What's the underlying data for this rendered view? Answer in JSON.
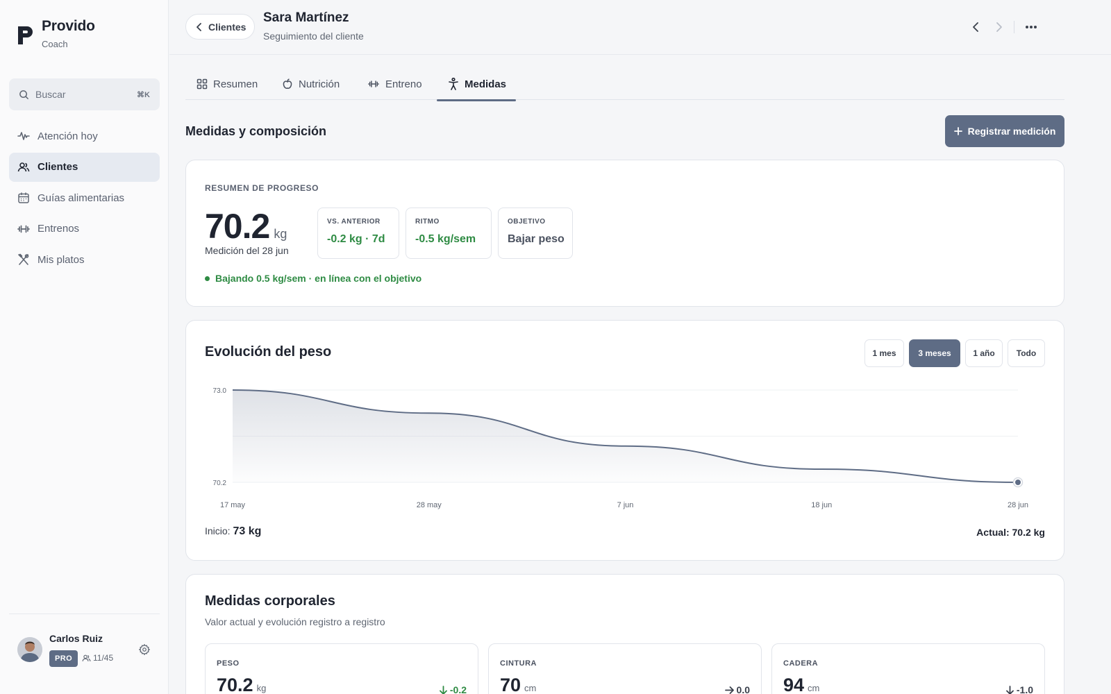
{
  "brand": {
    "name": "Provido",
    "sub": "Coach"
  },
  "search": {
    "placeholder": "Buscar",
    "shortcut": "⌘K"
  },
  "sidebar": {
    "items": [
      {
        "label": "Atención hoy",
        "icon": "activity-icon",
        "active": false
      },
      {
        "label": "Clientes",
        "icon": "users-icon",
        "active": true
      },
      {
        "label": "Guías alimentarias",
        "icon": "calendar-icon",
        "active": false
      },
      {
        "label": "Entrenos",
        "icon": "dumbbell-icon",
        "active": false
      },
      {
        "label": "Mis platos",
        "icon": "utensils-icon",
        "active": false
      }
    ]
  },
  "user": {
    "name": "Carlos Ruiz",
    "badge": "PRO",
    "clients": "11/45"
  },
  "header": {
    "back_label": "Clientes",
    "client_name": "Sara Martínez",
    "subtitle": "Seguimiento del cliente"
  },
  "tabs": [
    {
      "label": "Resumen",
      "icon": "grid-icon",
      "active": false
    },
    {
      "label": "Nutrición",
      "icon": "apple-icon",
      "active": false
    },
    {
      "label": "Entreno",
      "icon": "dumbbell-icon",
      "active": false
    },
    {
      "label": "Medidas",
      "icon": "body-icon",
      "active": true
    }
  ],
  "section": {
    "title": "Medidas y composición",
    "action_label": "Registrar medición"
  },
  "progress": {
    "eyebrow": "RESUMEN DE PROGRESO",
    "weight": "70.2",
    "unit": "kg",
    "date": "Medición del 28 jun",
    "stats": [
      {
        "label": "VS. ANTERIOR",
        "value": "-0.2 kg · 7d",
        "tone": "green"
      },
      {
        "label": "RITMO",
        "value": "-0.5 kg/sem",
        "tone": "green"
      },
      {
        "label": "OBJETIVO",
        "value": "Bajar peso",
        "tone": "neutral"
      }
    ],
    "status": "Bajando 0.5 kg/sem · en línea con el objetivo"
  },
  "weight_chart": {
    "title": "Evolución del peso",
    "ranges": [
      {
        "label": "1 mes",
        "active": false
      },
      {
        "label": "3 meses",
        "active": true
      },
      {
        "label": "1 año",
        "active": false
      },
      {
        "label": "Todo",
        "active": false
      }
    ],
    "start_label": "Inicio:",
    "start_value": "73 kg",
    "current_label": "Actual: 70.2 kg"
  },
  "chart_data": {
    "type": "area",
    "x": [
      "17 may",
      "28 may",
      "7 jun",
      "18 jun",
      "28 jun"
    ],
    "series": [
      {
        "values": [
          73.0,
          72.3,
          71.3,
          70.6,
          70.2
        ]
      }
    ],
    "ylim": [
      70.2,
      73.0
    ],
    "yticks": [
      "73.0",
      "70.2"
    ],
    "grid": true,
    "colors": {
      "line": "#5e6c85",
      "fill": "#c4c9d3"
    }
  },
  "body_measures": {
    "title": "Medidas corporales",
    "subtitle": "Valor actual y evolución registro a registro",
    "items": [
      {
        "label": "PESO",
        "value": "70.2",
        "unit": "kg",
        "delta": "-0.2",
        "direction": "down",
        "tone": "green"
      },
      {
        "label": "CINTURA",
        "value": "70",
        "unit": "cm",
        "delta": "0.0",
        "direction": "flat",
        "tone": "neutral"
      },
      {
        "label": "CADERA",
        "value": "94",
        "unit": "cm",
        "delta": "-1.0",
        "direction": "down",
        "tone": "neutral"
      }
    ]
  },
  "colors": {
    "accent": "#5e6c85",
    "positive": "#2e8b43",
    "text": "#1f2430"
  }
}
